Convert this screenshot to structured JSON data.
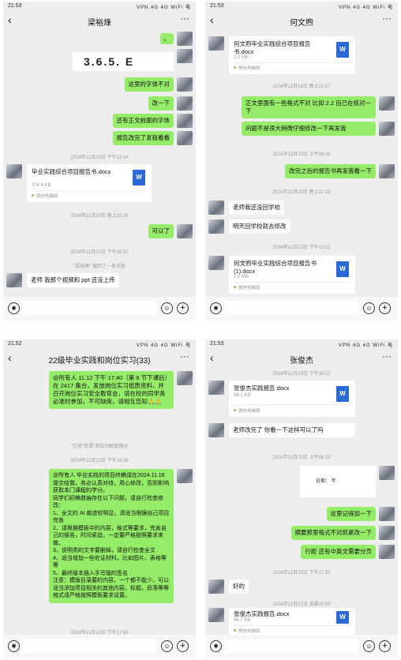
{
  "p1": {
    "time": "21:53",
    "status_icons": "VPN 4G 4G WiFi 电",
    "title": "梁裕烽",
    "m1": "。",
    "snippet": "3.6.5. E",
    "m2": "这里的字体不对",
    "m3": "改一下",
    "m4": "还有正文前面的字体",
    "m5": "报告改完了发我看看",
    "t1": "2024年11月20日 下午13:14",
    "file": {
      "name": "毕业实践综合项目报告书.docx",
      "size": "374.4 KB",
      "src": "微信电脑版"
    },
    "t2": "2024年11月20日 晚上22:38",
    "m6": "可以了",
    "t3": "2024年11月21日 下午16:37",
    "sys": "\"梁裕烽\" 撤回了一条消息",
    "m7": "老师 我那个视频和 ppt 还没上传"
  },
  "p2": {
    "time": "21:53",
    "status_icons": "VPN 4G 4G WiFi 电",
    "title": "何文煦",
    "file1": {
      "name": "何文煦毕业实践综合项目报告书.docx",
      "size": "2.2 MB",
      "src": "微信电脑版"
    },
    "t1": "2024年11月18日 晚上21:57",
    "m1": "正文里面有一些格式不对 比如 2.2 自己在核对一下",
    "m2": "问题不是很大稍微仔细修改一下再发我",
    "t2": "2024年11月20日 上午08:26",
    "m3": "改完之后的报告书再发我看一下",
    "t3": "2024年11月20日 晚上21:19",
    "m4": "老师我还没回学校",
    "m5": "明天回学校就去修改",
    "t4": "2024年11月21日 下午13:32",
    "file2": {
      "name": "何文煦毕业实践综合项目报告书(1).docx",
      "size": "2.1 MB",
      "src": "微信电脑版"
    }
  },
  "p3": {
    "time": "21:52",
    "status_icons": "VPN 4G 4G WiFi 电",
    "title": "22级毕业实践和岗位实习(33)",
    "m1": "@所有人 11.12 下午 17:40（第 8 节下课后）在 2417 集合，发放岗位实习纸质资料，并召开岗位实习安全教育会，请在校的同学务必准时参加，不可缺席，请相互告知🙏🙏",
    "sys": "\"已将\"老谭\"添加为群管理员",
    "t1": "2024年11月12日 下午14:38",
    "m2": "@所有人 毕业实践的项目终稿请在2024.11.16 提交给我，务必认真对待，用心修改，否则影响获取本门课程的学分。\n同学们初稿普遍存在以下问题，请自行检查修改：\n1、全文的 AI 痕迹较明显，请适当根据自己项目完善\n2、请根据模板中的内容，格式等要求，完善自己的报告，时间紧迫，一定要严格按照要求来做。\n3、说明类的文字要删掉，请自行检查全文\n4、适当增加一些佐证材料，比如图片、表格等等\n5、最终版本插入手写版的签名\n注意：模版目录要的内容，一个都不能少，可以适当添加项目相关的其他内容。标题，段落等等格式请严格按照模板要求设置。",
    "t2": "2024年11月12日 下午17:59"
  },
  "p4": {
    "time": "21:53",
    "status_icons": "VPN 4G 4G WiFi 电",
    "title": "张俊杰",
    "t1": "2024年11月19日 下午16:22",
    "file1": {
      "name": "张俊杰实践报告.docx",
      "size": "88.1 KB",
      "src": "微信电脑版"
    },
    "m1": "老师改完了 你看一下这样可以了吗",
    "t2": "2024年11月20日 上午08:19",
    "snippet": "日期：     年",
    "m2": "这里记得加一下",
    "m3": "摘要那里格式不对抓紧改一下",
    "m4": "行距 还有中英文需要分页",
    "t3": "2024年11月20日 下午17:53",
    "m5": "好的",
    "t4": "2024年11月21日 凌晨00:59",
    "file2": {
      "name": "张俊杰实践报告.docx",
      "size": "86.7 KB",
      "src": "微信电脑版"
    }
  },
  "icons": {
    "back": "‹",
    "more": "···",
    "voice": "◉",
    "emoji": "☺",
    "plus": "+"
  },
  "colors": {
    "bg": "#ededed",
    "out_bubble": "#95ec69",
    "in_bubble": "#ffffff",
    "word_icon": "#2b6ad6"
  }
}
